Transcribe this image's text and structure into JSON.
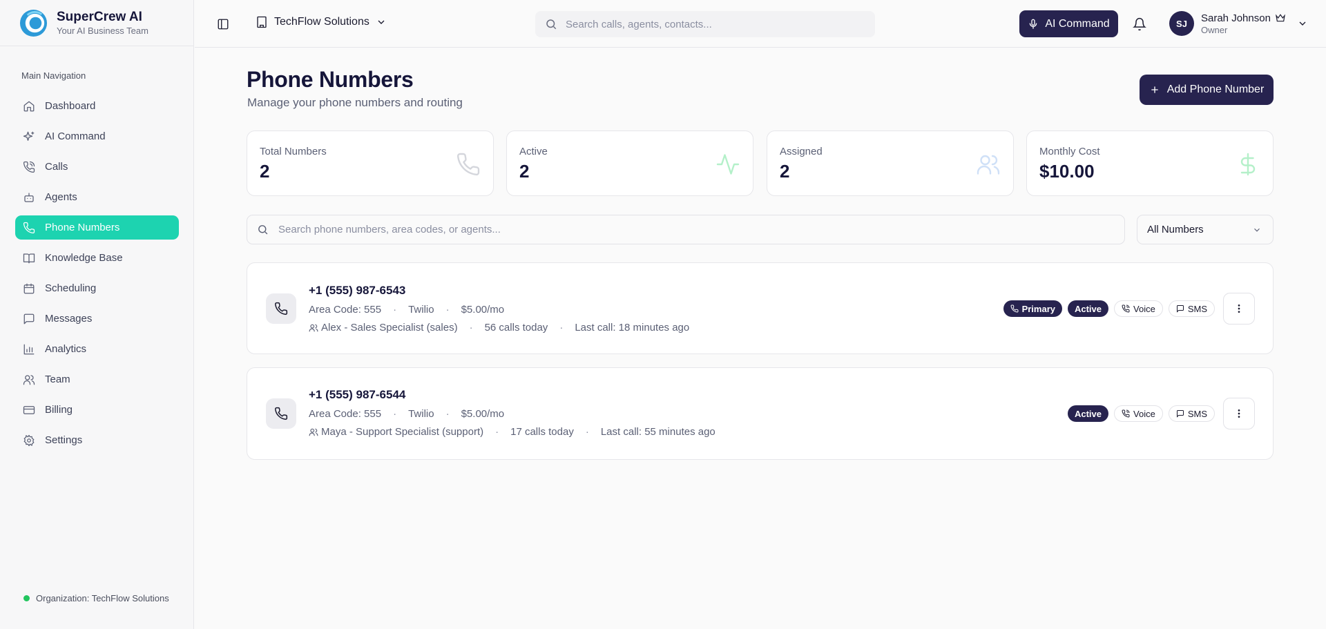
{
  "brand": {
    "name": "SuperCrew AI",
    "tagline": "Your AI Business Team"
  },
  "sidebar": {
    "heading": "Main Navigation",
    "items": [
      {
        "label": "Dashboard",
        "icon": "home-icon"
      },
      {
        "label": "AI Command",
        "icon": "sparkles-icon"
      },
      {
        "label": "Calls",
        "icon": "phone-call-icon"
      },
      {
        "label": "Agents",
        "icon": "bot-icon"
      },
      {
        "label": "Phone Numbers",
        "icon": "phone-icon",
        "active": true
      },
      {
        "label": "Knowledge Base",
        "icon": "book-icon"
      },
      {
        "label": "Scheduling",
        "icon": "calendar-icon"
      },
      {
        "label": "Messages",
        "icon": "message-icon"
      },
      {
        "label": "Analytics",
        "icon": "bar-chart-icon"
      },
      {
        "label": "Team",
        "icon": "users-icon"
      },
      {
        "label": "Billing",
        "icon": "credit-card-icon"
      },
      {
        "label": "Settings",
        "icon": "gear-icon"
      }
    ],
    "footer": "Organization: TechFlow Solutions"
  },
  "header": {
    "org": "TechFlow Solutions",
    "search_placeholder": "Search calls, agents, contacts...",
    "ai_command": "AI Command",
    "user": {
      "initials": "SJ",
      "name": "Sarah Johnson",
      "role": "Owner"
    }
  },
  "page": {
    "title": "Phone Numbers",
    "subtitle": "Manage your phone numbers and routing",
    "add_button": "Add Phone Number"
  },
  "stats": [
    {
      "label": "Total Numbers",
      "value": "2",
      "icon": "phone-icon",
      "color": "#9aa0ad"
    },
    {
      "label": "Active",
      "value": "2",
      "icon": "activity-icon",
      "color": "#86efac"
    },
    {
      "label": "Assigned",
      "value": "2",
      "icon": "users-icon",
      "color": "#a7c7f5"
    },
    {
      "label": "Monthly Cost",
      "value": "$10.00",
      "icon": "dollar-icon",
      "color": "#86efac"
    }
  ],
  "search": {
    "placeholder": "Search phone numbers, area codes, or agents..."
  },
  "filter": {
    "selected": "All Numbers"
  },
  "numbers": [
    {
      "number": "+1 (555) 987-6543",
      "area_code": "Area Code: 555",
      "provider": "Twilio",
      "price": "$5.00/mo",
      "agent": "Alex - Sales Specialist (sales)",
      "calls": "56 calls today",
      "last_call": "Last call: 18 minutes ago",
      "primary": "Primary",
      "status": "Active",
      "voice": "Voice",
      "sms": "SMS"
    },
    {
      "number": "+1 (555) 987-6544",
      "area_code": "Area Code: 555",
      "provider": "Twilio",
      "price": "$5.00/mo",
      "agent": "Maya - Support Specialist (support)",
      "calls": "17 calls today",
      "last_call": "Last call: 55 minutes ago",
      "status": "Active",
      "voice": "Voice",
      "sms": "SMS"
    }
  ]
}
